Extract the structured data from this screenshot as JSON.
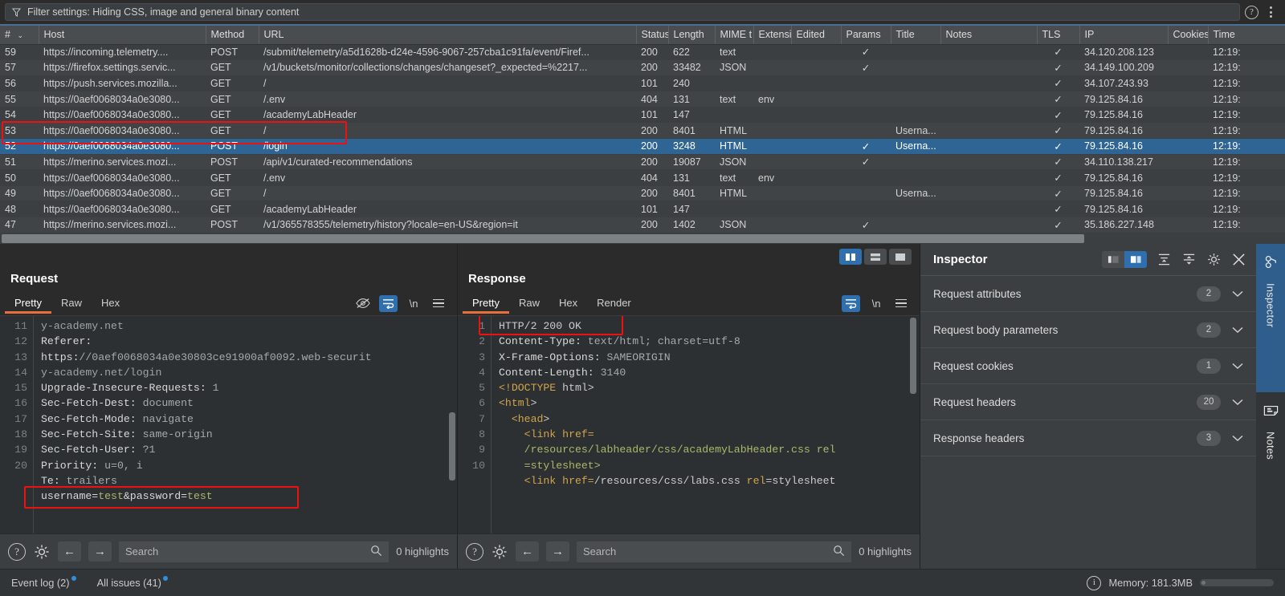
{
  "filter": {
    "text": "Filter settings: Hiding CSS, image and general binary content",
    "icon": "funnel-icon"
  },
  "top_right": {
    "help_icon": "question-circle-icon",
    "menu_icon": "kebab-menu-icon"
  },
  "table": {
    "columns": [
      "#",
      "Host",
      "Method",
      "URL",
      "Status",
      "Length",
      "MIME t",
      "Extensi",
      "Edited",
      "Params",
      "Title",
      "Notes",
      "TLS",
      "IP",
      "Cookies",
      "Time"
    ],
    "sort_indicator": "chevron-down-icon",
    "rows": [
      {
        "num": "59",
        "host": "https://incoming.telemetry....",
        "method": "POST",
        "url": "/submit/telemetry/a5d1628b-d24e-4596-9067-257cba1c91fa/event/Firef...",
        "status": "200",
        "length": "622",
        "mime": "text",
        "ext": "",
        "edited": "",
        "params": "✓",
        "title": "",
        "notes": "",
        "tls": "✓",
        "ip": "34.120.208.123",
        "cookies": "",
        "time": "12:19:"
      },
      {
        "num": "57",
        "host": "https://firefox.settings.servic...",
        "method": "GET",
        "url": "/v1/buckets/monitor/collections/changes/changeset?_expected=%2217...",
        "status": "200",
        "length": "33482",
        "mime": "JSON",
        "ext": "",
        "edited": "",
        "params": "✓",
        "title": "",
        "notes": "",
        "tls": "✓",
        "ip": "34.149.100.209",
        "cookies": "",
        "time": "12:19:"
      },
      {
        "num": "56",
        "host": "https://push.services.mozilla...",
        "method": "GET",
        "url": "/",
        "status": "101",
        "length": "240",
        "mime": "",
        "ext": "",
        "edited": "",
        "params": "",
        "title": "",
        "notes": "",
        "tls": "✓",
        "ip": "34.107.243.93",
        "cookies": "",
        "time": "12:19:"
      },
      {
        "num": "55",
        "host": "https://0aef0068034a0e3080...",
        "method": "GET",
        "url": "/.env",
        "status": "404",
        "length": "131",
        "mime": "text",
        "ext": "env",
        "edited": "",
        "params": "",
        "title": "",
        "notes": "",
        "tls": "✓",
        "ip": "79.125.84.16",
        "cookies": "",
        "time": "12:19:"
      },
      {
        "num": "54",
        "host": "https://0aef0068034a0e3080...",
        "method": "GET",
        "url": "/academyLabHeader",
        "status": "101",
        "length": "147",
        "mime": "",
        "ext": "",
        "edited": "",
        "params": "",
        "title": "",
        "notes": "",
        "tls": "✓",
        "ip": "79.125.84.16",
        "cookies": "",
        "time": "12:19:"
      },
      {
        "num": "53",
        "host": "https://0aef0068034a0e3080...",
        "method": "GET",
        "url": "/",
        "status": "200",
        "length": "8401",
        "mime": "HTML",
        "ext": "",
        "edited": "",
        "params": "",
        "title": "Userna...",
        "notes": "",
        "tls": "✓",
        "ip": "79.125.84.16",
        "cookies": "",
        "time": "12:19:"
      },
      {
        "num": "52",
        "host": "https://0aef0068034a0e3080...",
        "method": "POST",
        "url": "/login",
        "status": "200",
        "length": "3248",
        "mime": "HTML",
        "ext": "",
        "edited": "",
        "params": "✓",
        "title": "Userna...",
        "notes": "",
        "tls": "✓",
        "ip": "79.125.84.16",
        "cookies": "",
        "time": "12:19:",
        "selected": true
      },
      {
        "num": "51",
        "host": "https://merino.services.mozi...",
        "method": "POST",
        "url": "/api/v1/curated-recommendations",
        "status": "200",
        "length": "19087",
        "mime": "JSON",
        "ext": "",
        "edited": "",
        "params": "✓",
        "title": "",
        "notes": "",
        "tls": "✓",
        "ip": "34.110.138.217",
        "cookies": "",
        "time": "12:19:"
      },
      {
        "num": "50",
        "host": "https://0aef0068034a0e3080...",
        "method": "GET",
        "url": "/.env",
        "status": "404",
        "length": "131",
        "mime": "text",
        "ext": "env",
        "edited": "",
        "params": "",
        "title": "",
        "notes": "",
        "tls": "✓",
        "ip": "79.125.84.16",
        "cookies": "",
        "time": "12:19:"
      },
      {
        "num": "49",
        "host": "https://0aef0068034a0e3080...",
        "method": "GET",
        "url": "/",
        "status": "200",
        "length": "8401",
        "mime": "HTML",
        "ext": "",
        "edited": "",
        "params": "",
        "title": "Userna...",
        "notes": "",
        "tls": "✓",
        "ip": "79.125.84.16",
        "cookies": "",
        "time": "12:19:"
      },
      {
        "num": "48",
        "host": "https://0aef0068034a0e3080...",
        "method": "GET",
        "url": "/academyLabHeader",
        "status": "101",
        "length": "147",
        "mime": "",
        "ext": "",
        "edited": "",
        "params": "",
        "title": "",
        "notes": "",
        "tls": "✓",
        "ip": "79.125.84.16",
        "cookies": "",
        "time": "12:19:"
      },
      {
        "num": "47",
        "host": "https://merino.services.mozi...",
        "method": "POST",
        "url": "/v1/365578355/telemetry/history?locale=en-US&region=it",
        "status": "200",
        "length": "1402",
        "mime": "JSON",
        "ext": "",
        "edited": "",
        "params": "✓",
        "title": "",
        "notes": "",
        "tls": "✓",
        "ip": "35.186.227.148",
        "cookies": "",
        "time": "12:19:"
      }
    ]
  },
  "request_panel": {
    "title": "Request",
    "tabs": [
      "Pretty",
      "Raw",
      "Hex"
    ],
    "active_tab": "Pretty",
    "icons": [
      "eye-slash-icon",
      "word-wrap-icon",
      "newline-icon",
      "hamburger-menu-icon"
    ],
    "newline_label": "\\n",
    "lines": [
      {
        "no": "",
        "text": "y-academy.net",
        "cont": true
      },
      {
        "no": "11",
        "text": "Referer:"
      },
      {
        "no": "",
        "text": "https://0aef0068034a0e30803ce91900af0092.web-securit",
        "cont": true
      },
      {
        "no": "",
        "text": "y-academy.net/login",
        "cont": true
      },
      {
        "no": "12",
        "text": "Upgrade-Insecure-Requests: 1"
      },
      {
        "no": "13",
        "text": "Sec-Fetch-Dest: document"
      },
      {
        "no": "14",
        "text": "Sec-Fetch-Mode: navigate"
      },
      {
        "no": "15",
        "text": "Sec-Fetch-Site: same-origin"
      },
      {
        "no": "16",
        "text": "Sec-Fetch-User: ?1"
      },
      {
        "no": "17",
        "text": "Priority: u=0, i"
      },
      {
        "no": "18",
        "text": "Te: trailers"
      },
      {
        "no": "19",
        "text": ""
      },
      {
        "no": "20",
        "text": "username=test&password=test",
        "highlight": true
      }
    ],
    "body_highlight": "username=test&password=test",
    "bottom": {
      "help_icon": "question-circle-icon",
      "settings_icon": "gear-icon",
      "back_icon": "arrow-left-icon",
      "forward_icon": "arrow-right-icon",
      "search_placeholder": "Search",
      "search_icon": "magnifier-icon",
      "highlights": "0 highlights"
    }
  },
  "response_panel": {
    "title": "Response",
    "tabs": [
      "Pretty",
      "Raw",
      "Hex",
      "Render"
    ],
    "active_tab": "Pretty",
    "layout_buttons": [
      "vertical-split-icon",
      "horizontal-split-icon",
      "single-pane-icon"
    ],
    "active_layout": "vertical-split-icon",
    "icons": [
      "word-wrap-icon",
      "newline-icon",
      "hamburger-menu-icon"
    ],
    "newline_label": "\\n",
    "lines": [
      {
        "no": "1",
        "text": "HTTP/2 200 OK",
        "highlight": true
      },
      {
        "no": "2",
        "text": "Content-Type: text/html; charset=utf-8"
      },
      {
        "no": "3",
        "text": "X-Frame-Options: SAMEORIGIN"
      },
      {
        "no": "4",
        "text": "Content-Length: 3140"
      },
      {
        "no": "5",
        "text": ""
      },
      {
        "no": "6",
        "text": "<!DOCTYPE html>"
      },
      {
        "no": "7",
        "text": "<html>"
      },
      {
        "no": "8",
        "text": "  <head>"
      },
      {
        "no": "9",
        "text": "    <link href="
      },
      {
        "no": "",
        "text": "    /resources/labheader/css/academyLabHeader.css rel",
        "cont": true
      },
      {
        "no": "",
        "text": "    =stylesheet>",
        "cont": true
      },
      {
        "no": "10",
        "text": "    <link href=/resources/css/labs.css rel=stylesheet"
      }
    ],
    "status_line": "HTTP/2 200 OK",
    "bottom": {
      "help_icon": "question-circle-icon",
      "settings_icon": "gear-icon",
      "back_icon": "arrow-left-icon",
      "forward_icon": "arrow-right-icon",
      "search_placeholder": "Search",
      "search_icon": "magnifier-icon",
      "highlights": "0 highlights"
    }
  },
  "inspector": {
    "title": "Inspector",
    "layout_toggle": [
      "pane-left-icon",
      "pane-right-icon"
    ],
    "active_layout": "pane-right-icon",
    "icons": [
      "expand-all-icon",
      "collapse-all-icon",
      "gear-icon",
      "close-icon"
    ],
    "sections": [
      {
        "label": "Request attributes",
        "count": "2",
        "chevron": "chevron-down-icon"
      },
      {
        "label": "Request body parameters",
        "count": "2",
        "chevron": "chevron-down-icon"
      },
      {
        "label": "Request cookies",
        "count": "1",
        "chevron": "chevron-down-icon"
      },
      {
        "label": "Request headers",
        "count": "20",
        "chevron": "chevron-down-icon"
      },
      {
        "label": "Response headers",
        "count": "3",
        "chevron": "chevron-down-icon"
      }
    ],
    "vertical_tabs": [
      {
        "label": "Inspector",
        "icon": "inspector-glasses-icon",
        "active": true
      },
      {
        "label": "Notes",
        "icon": "notes-document-icon",
        "active": false
      }
    ]
  },
  "statusbar": {
    "event_log": "Event log (2)",
    "all_issues": "All issues (41)",
    "memory": "Memory: 181.3MB",
    "info_icon": "info-circle-icon"
  },
  "colors": {
    "accent_blue": "#2f6fae",
    "selection_blue": "#2f6594",
    "tab_underline": "#e8703a",
    "highlight_red": "#ee1111",
    "badge_blue": "#2f8ee0"
  }
}
